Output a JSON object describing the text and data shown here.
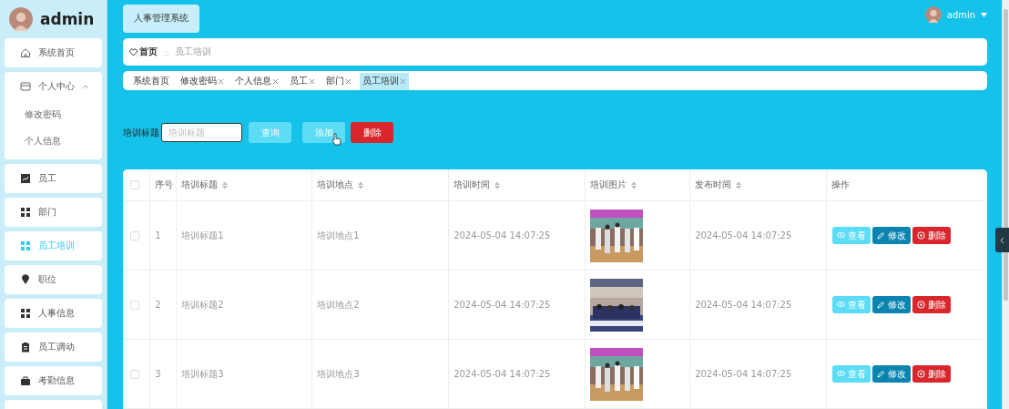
{
  "sidebar": {
    "title": "admin",
    "items": [
      {
        "label": "系统首页",
        "selected": false
      },
      {
        "label": "个人中心",
        "selected": false,
        "expanded": true,
        "children": [
          {
            "label": "修改密码",
            "selected": false
          },
          {
            "label": "个人信息",
            "selected": false
          }
        ]
      },
      {
        "label": "员工",
        "selected": false
      },
      {
        "label": "部门",
        "selected": false
      },
      {
        "label": "员工培训",
        "selected": true
      },
      {
        "label": "职位",
        "selected": false
      },
      {
        "label": "人事信息",
        "selected": false
      },
      {
        "label": "员工调动",
        "selected": false
      },
      {
        "label": "考勤信息",
        "selected": false
      }
    ]
  },
  "header": {
    "system_button": "人事管理系统",
    "user": "admin"
  },
  "breadcrumb": {
    "home": "首页",
    "separator": "::",
    "current": "员工培训"
  },
  "tabs": [
    {
      "label": "系统首页",
      "closable": false,
      "selected": false
    },
    {
      "label": "修改密码",
      "closable": true,
      "selected": false
    },
    {
      "label": "个人信息",
      "closable": true,
      "selected": false
    },
    {
      "label": "员工",
      "closable": true,
      "selected": false
    },
    {
      "label": "部门",
      "closable": true,
      "selected": false
    },
    {
      "label": "员工培训",
      "closable": true,
      "selected": true
    }
  ],
  "search": {
    "label": "培训标题",
    "placeholder": "培训标题",
    "buttons": [
      {
        "label": "查询",
        "kind": "search",
        "hovered": false
      },
      {
        "label": "添加",
        "kind": "add",
        "hovered": true
      },
      {
        "label": "删除",
        "kind": "delete",
        "hovered": false
      }
    ]
  },
  "table": {
    "checked": false,
    "columns": [
      {
        "label": "序号",
        "sortable": false
      },
      {
        "label": "培训标题",
        "sortable": true
      },
      {
        "label": "培训地点",
        "sortable": true
      },
      {
        "label": "培训时间",
        "sortable": true
      },
      {
        "label": "培训图片",
        "sortable": true
      },
      {
        "label": "发布时间",
        "sortable": true
      },
      {
        "label": "操作",
        "sortable": false
      }
    ],
    "rows": [
      {
        "checked": false,
        "cells": [
          "1",
          "培训标题1",
          "培训地点1",
          "2024-05-04 14:07:25",
          {
            "kind": "picture"
          },
          "2024-05-04 14:07:25"
        ],
        "actions": [
          {
            "label": "查看",
            "kind": "view"
          },
          {
            "label": "修改",
            "kind": "edit"
          },
          {
            "label": "删除",
            "kind": "delete"
          }
        ]
      },
      {
        "checked": false,
        "cells": [
          "2",
          "培训标题2",
          "培训地点2",
          "2024-05-04 14:07:25",
          {
            "kind": "picture"
          },
          "2024-05-04 14:07:25"
        ],
        "actions": [
          {
            "label": "查看",
            "kind": "view"
          },
          {
            "label": "修改",
            "kind": "edit"
          },
          {
            "label": "删除",
            "kind": "delete"
          }
        ]
      },
      {
        "checked": false,
        "cells": [
          "3",
          "培训标题3",
          "培训地点3",
          "2024-05-04 14:07:25",
          {
            "kind": "picture"
          },
          "2024-05-04 14:07:25"
        ],
        "actions": [
          {
            "label": "查看",
            "kind": "view"
          },
          {
            "label": "修改",
            "kind": "edit"
          },
          {
            "label": "删除",
            "kind": "delete"
          }
        ]
      }
    ]
  }
}
